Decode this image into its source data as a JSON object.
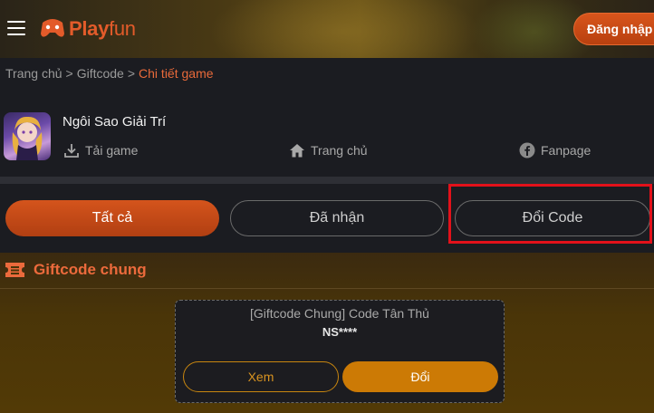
{
  "header": {
    "logo_text_1": "Play",
    "logo_text_2": "fun",
    "login_label": "Đăng nhập"
  },
  "breadcrumb": {
    "items": [
      "Trang chủ",
      "Giftcode",
      "Chi tiết game"
    ],
    "separator": ">"
  },
  "game": {
    "title": "Ngôi Sao Giải Trí",
    "links": {
      "download": "Tải game",
      "home": "Trang chủ",
      "fanpage": "Fanpage"
    }
  },
  "tabs": {
    "all": "Tất cả",
    "received": "Đã nhận",
    "redeem": "Đổi Code"
  },
  "section": {
    "title": "Giftcode chung"
  },
  "giftcode": {
    "name": "[Giftcode Chung] Code Tân Thủ",
    "code": "NS****",
    "view_label": "Xem",
    "redeem_label": "Đổi"
  },
  "colors": {
    "accent": "#d4541c",
    "highlight": "#e3111a",
    "redeem_button": "#cc7a05"
  }
}
